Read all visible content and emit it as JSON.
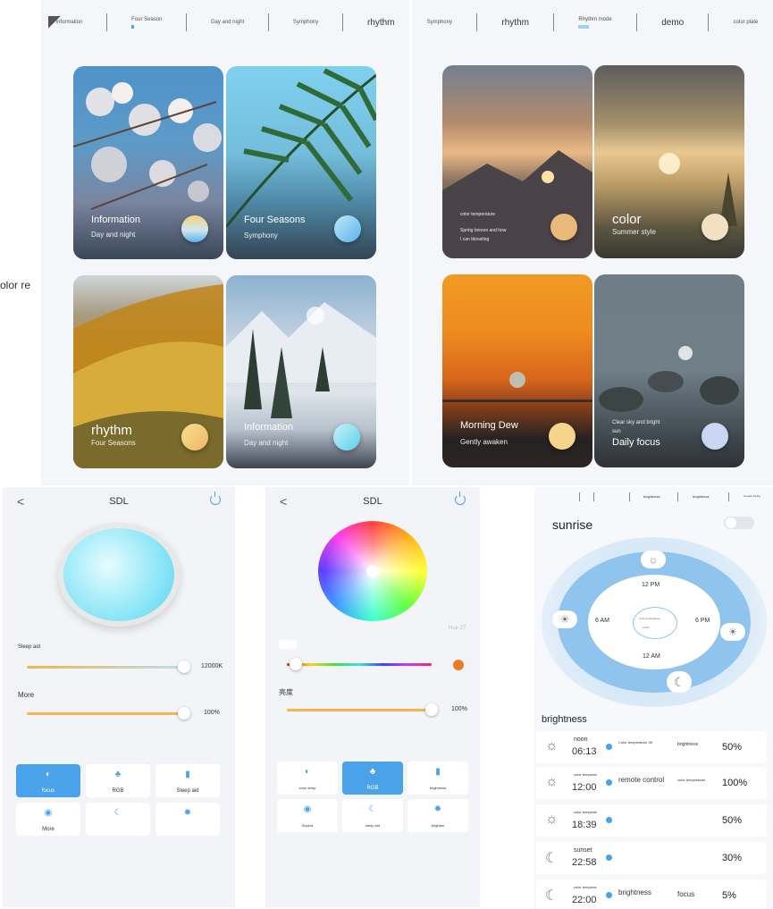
{
  "side_text": "olor re",
  "left_panel": {
    "tabs": [
      {
        "label": "Information"
      },
      {
        "label": "Four Season"
      },
      {
        "label": "Day and night"
      },
      {
        "label": "Symphony"
      },
      {
        "label": "rhythm"
      }
    ],
    "cards": [
      {
        "t1": "Information",
        "t2": "Day and night"
      },
      {
        "t1": "Four Seasons",
        "t2": "Symphony"
      },
      {
        "t1": "rhythm",
        "t2": "Four Seasons"
      },
      {
        "t1": "Information",
        "t2": "Day and night"
      }
    ]
  },
  "right_panel": {
    "tabs": [
      {
        "label": "Symphony"
      },
      {
        "label": "rhythm"
      },
      {
        "label": "Rhythm mode"
      },
      {
        "label": "demo"
      },
      {
        "label": "color plate"
      }
    ],
    "cards": [
      {
        "t_small": "color temperature",
        "t2a": "Spring breeze and how",
        "t2b": "I can bloosting"
      },
      {
        "t1": "color",
        "t2": "Summer style"
      },
      {
        "t1": "Morning Dew",
        "t2": "Gently awaken"
      },
      {
        "t1a": "Clear sky and bright",
        "t1b": "sun",
        "t2": "Daily focus"
      }
    ]
  },
  "phone1": {
    "title": "SDL",
    "back": "<",
    "label_a": "Sleep aid",
    "value_a": "12000K",
    "label_b": "More",
    "value_b": "100%",
    "buttons": [
      {
        "label": "focus",
        "active": true,
        "icon": "contrast-icon"
      },
      {
        "label": "RGB",
        "active": false,
        "icon": "palette-icon"
      },
      {
        "label": "Sleep aid",
        "active": false,
        "icon": "device-icon"
      },
      {
        "label": "More",
        "active": false,
        "icon": "eye-icon"
      },
      {
        "label": "",
        "active": false,
        "icon": "moon-icon"
      },
      {
        "label": "",
        "active": false,
        "icon": "settings-icon"
      }
    ]
  },
  "phone2": {
    "title": "SDL",
    "back": "<",
    "hue_label": "Hue 27",
    "label_b": "亮度",
    "value_b": "100%",
    "buttons": [
      {
        "label": "color temp",
        "active": false,
        "icon": "contrast-icon"
      },
      {
        "label": "RGB",
        "active": true,
        "icon": "palette-icon"
      },
      {
        "label": "brightness",
        "active": false,
        "icon": "device-icon"
      },
      {
        "label": "Sophia",
        "active": false,
        "icon": "eye-icon"
      },
      {
        "label": "sleep aid",
        "active": false,
        "icon": "moon-icon"
      },
      {
        "label": "brighten",
        "active": false,
        "icon": "settings-icon"
      }
    ]
  },
  "phone3": {
    "tabs": [
      "brightness",
      "brightness",
      "Current timing"
    ],
    "title": "sunrise",
    "dial": {
      "top": "12 PM",
      "left": "6 AM",
      "right": "6 PM",
      "bottom": "12 AM",
      "center_a": "color temperature",
      "center_b": "at 0%"
    },
    "section": "brightness",
    "rows": [
      {
        "name": "noon",
        "time": "06:13",
        "desc": "Color temperature 3K",
        "desc2": "brightness",
        "pct": "50%",
        "icon": "sunrise-icon"
      },
      {
        "name": "color temperat",
        "time": "12:00",
        "desc": "remote control",
        "desc2": "color temperature",
        "pct": "100%",
        "icon": "sun-icon"
      },
      {
        "name": "color temperat",
        "time": "18:39",
        "desc": "",
        "desc2": "",
        "pct": "50%",
        "icon": "sunset-icon"
      },
      {
        "name": "sunset",
        "time": "22:58",
        "desc": "",
        "desc2": "",
        "pct": "30%",
        "icon": "moon-icon"
      },
      {
        "name": "color temperat",
        "time": "22:00",
        "desc": "brightness",
        "desc2": "focus",
        "pct": "5%",
        "icon": "moon-star-icon"
      }
    ]
  }
}
